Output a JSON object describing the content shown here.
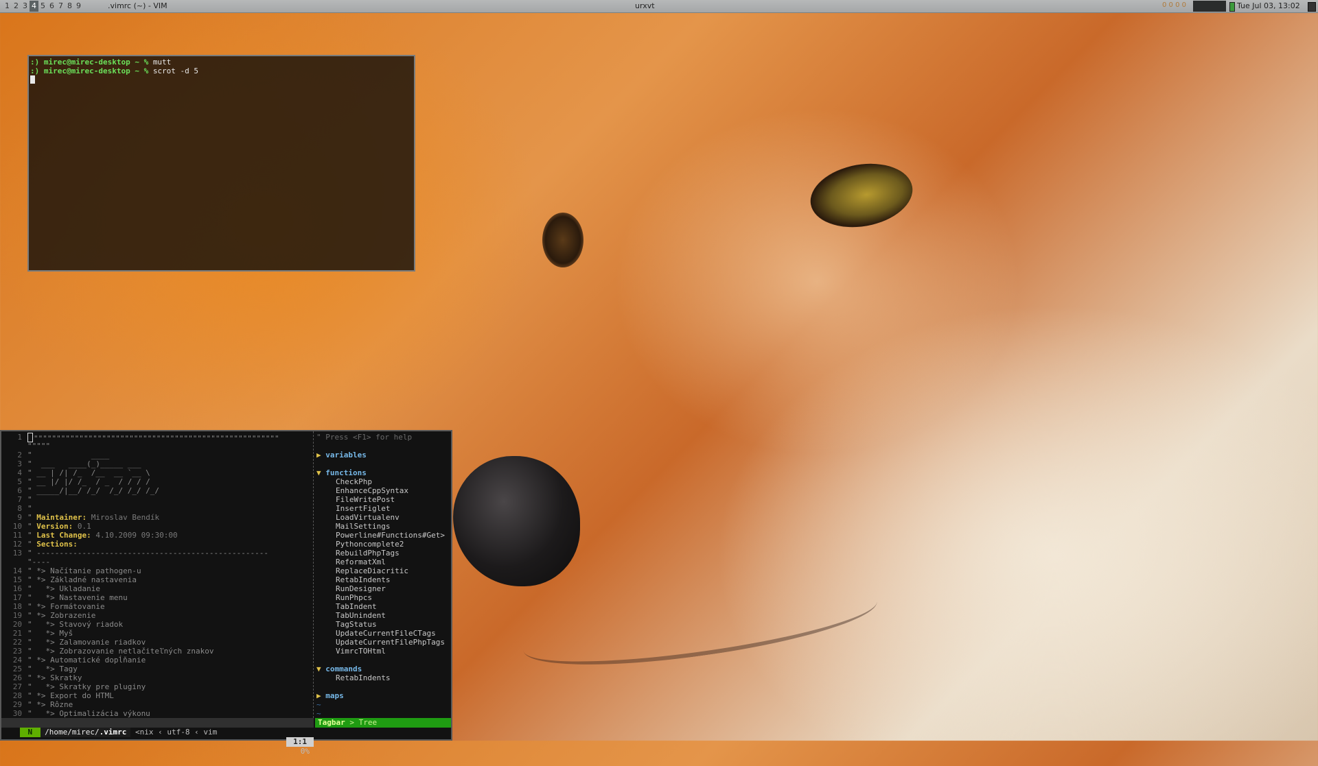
{
  "topbar": {
    "workspaces": [
      {
        "label": "1",
        "active": false
      },
      {
        "label": "2",
        "active": false
      },
      {
        "label": "3",
        "active": false
      },
      {
        "label": "4",
        "active": true
      },
      {
        "label": "5",
        "active": false
      },
      {
        "label": "6",
        "active": false
      },
      {
        "label": "7",
        "active": false
      },
      {
        "label": "8",
        "active": false
      },
      {
        "label": "9",
        "active": false
      }
    ],
    "window_title": ".vimrc (~) - VIM",
    "center_title": "urxvt",
    "tray_dots": "0 0 0 0",
    "clock": "Tue Jul 03, 13:02"
  },
  "terminal": {
    "lines": [
      {
        "prompt": ":) mirec@mirec-desktop ~ %",
        "cmd": "mutt"
      },
      {
        "prompt": ":) mirec@mirec-desktop ~ %",
        "cmd": "scrot -d 5"
      }
    ]
  },
  "vim": {
    "lines": [
      {
        "n": "1",
        "t": "\"\"\"\"\"\"\"\"\"\"\"\"\"\"\"\"\"\"\"\"\"\"\"\"\"\"\"\"\"\"\"\"\"\"\"\"\"\"\"\"\"\"\"\"\"\"\"\"\"\"\"\"\"\"",
        "k": "cursor"
      },
      {
        "n": "",
        "t": "\"\"\"\"\"",
        "k": "plain"
      },
      {
        "n": "2",
        "t": "\"             ____",
        "k": "plain"
      },
      {
        "n": "3",
        "t": "\"  ___   ____(_)_____ ___",
        "k": "plain"
      },
      {
        "n": "4",
        "t": "\" __ | /| /_  /__  __ `__ \\",
        "k": "plain"
      },
      {
        "n": "5",
        "t": "\" __ |/ |/ /_  / _  / / / /",
        "k": "plain"
      },
      {
        "n": "6",
        "t": "\" _____/|__/ /_/  /_/ /_/ /_/",
        "k": "plain"
      },
      {
        "n": "7",
        "t": "\"",
        "k": "plain"
      },
      {
        "n": "8",
        "t": "\"",
        "k": "plain"
      },
      {
        "n": "9",
        "label": "Maintainer:",
        "t": " Miroslav Bendík",
        "k": "field"
      },
      {
        "n": "10",
        "label": "Version:",
        "t": " 0.1",
        "k": "field"
      },
      {
        "n": "11",
        "label": "Last Change:",
        "t": " 4.10.2009 09:30:00",
        "k": "field"
      },
      {
        "n": "12",
        "label": "Sections:",
        "t": "",
        "k": "field"
      },
      {
        "n": "13",
        "t": "\" ---------------------------------------------------",
        "k": "plain"
      },
      {
        "n": "",
        "t": "\"----",
        "k": "plain"
      },
      {
        "n": "14",
        "t": "\" *> Načítanie pathogen-u",
        "k": "plain"
      },
      {
        "n": "15",
        "t": "\" *> Základné nastavenia",
        "k": "plain"
      },
      {
        "n": "16",
        "t": "\"   *> Ukladanie",
        "k": "plain"
      },
      {
        "n": "17",
        "t": "\"   *> Nastavenie menu",
        "k": "plain"
      },
      {
        "n": "18",
        "t": "\" *> Formátovanie",
        "k": "plain"
      },
      {
        "n": "19",
        "t": "\" *> Zobrazenie",
        "k": "plain"
      },
      {
        "n": "20",
        "t": "\"   *> Stavový riadok",
        "k": "plain"
      },
      {
        "n": "21",
        "t": "\"   *> Myš",
        "k": "plain"
      },
      {
        "n": "22",
        "t": "\"   *> Zalamovanie riadkov",
        "k": "plain"
      },
      {
        "n": "23",
        "t": "\"   *> Zobrazovanie netlačiteľných znakov",
        "k": "plain"
      },
      {
        "n": "24",
        "t": "\" *> Automatické dopĺňanie",
        "k": "plain"
      },
      {
        "n": "25",
        "t": "\"   *> Tagy",
        "k": "plain"
      },
      {
        "n": "26",
        "t": "\" *> Skratky",
        "k": "plain"
      },
      {
        "n": "27",
        "t": "\"   *> Skratky pre pluginy",
        "k": "plain"
      },
      {
        "n": "28",
        "t": "\" *> Export do HTML",
        "k": "plain"
      },
      {
        "n": "29",
        "t": "\" *> Rôzne",
        "k": "plain"
      },
      {
        "n": "30",
        "t": "\"   *> Optimalizácia výkonu",
        "k": "plain"
      }
    ],
    "statusline": {
      "mode": "N",
      "path_dir": "/home/mirec/",
      "path_file": ".vimrc",
      "format": "<nix",
      "encoding": "utf-8",
      "filetype": "vim",
      "percent": "0%",
      "position": "1:1"
    }
  },
  "tagbar": {
    "help": "\" Press <F1> for help",
    "groups": [
      {
        "arrow": "▶",
        "name": "variables",
        "items": []
      },
      {
        "arrow": "▼",
        "name": "functions",
        "items": [
          "CheckPhp",
          "EnhanceCppSyntax",
          "FileWritePost",
          "InsertFiglet",
          "LoadVirtualenv",
          "MailSettings",
          "Powerline#Functions#Get>",
          "Pythoncomplete2",
          "RebuildPhpTags",
          "ReformatXml",
          "ReplaceDiacritic",
          "RetabIndents",
          "RunDesigner",
          "RunPhpcs",
          "TabIndent",
          "TabUnindent",
          "TagStatus",
          "UpdateCurrentFileCTags",
          "UpdateCurrentFilePhpTags",
          "VimrcTOHtml"
        ]
      },
      {
        "arrow": "▼",
        "name": "commands",
        "items": [
          "RetabIndents"
        ]
      },
      {
        "arrow": "▶",
        "name": "maps",
        "items": []
      }
    ],
    "tildes": [
      "~",
      "~"
    ],
    "status_name": "Tagbar",
    "status_sep": ">",
    "status_mode": "Tree"
  }
}
